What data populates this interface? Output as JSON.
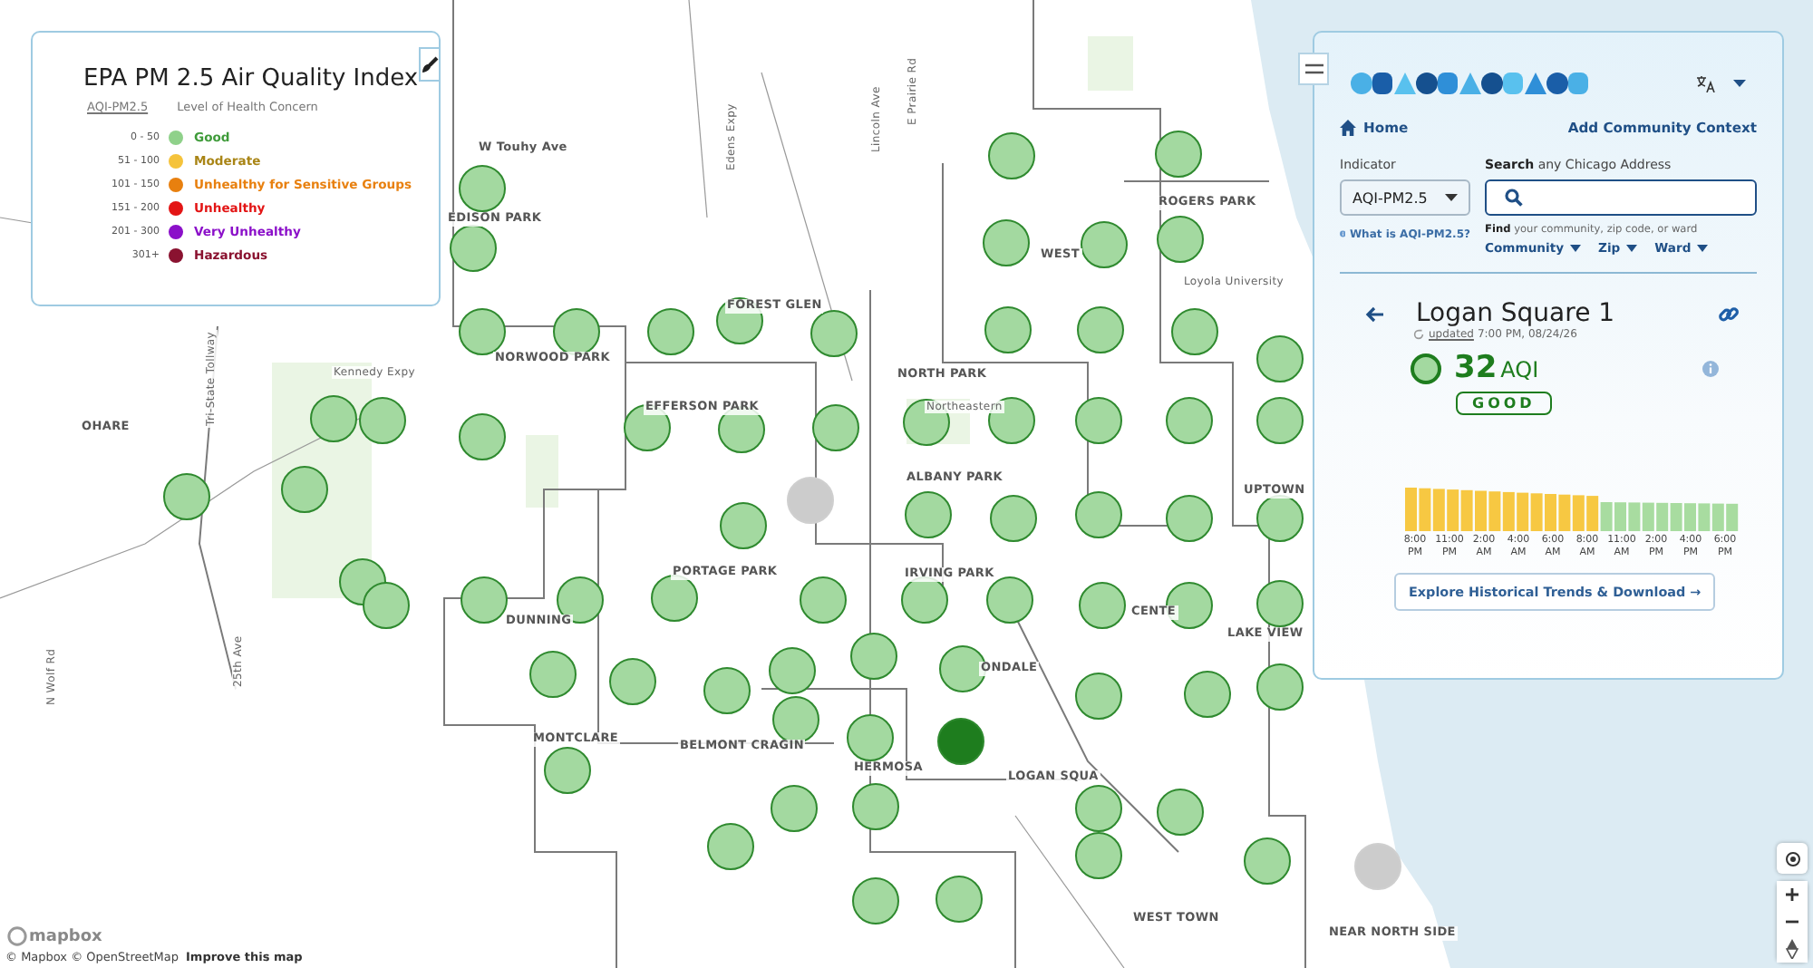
{
  "legend": {
    "title": "EPA PM 2.5 Air Quality Index",
    "column_1": "AQI-PM2.5",
    "column_2": "Level of Health Concern",
    "rows": [
      {
        "range": "0 - 50",
        "label": "Good",
        "color": "#8fd18a"
      },
      {
        "range": "51 - 100",
        "label": "Moderate",
        "color": "#f5c33b"
      },
      {
        "range": "101 - 150",
        "label": "Unhealthy for Sensitive Groups",
        "color": "#e8800f"
      },
      {
        "range": "151 - 200",
        "label": "Unhealthy",
        "color": "#e31515"
      },
      {
        "range": "201 - 300",
        "label": "Very Unhealthy",
        "color": "#8b10c9"
      },
      {
        "range": "301+",
        "label": "Hazardous",
        "color": "#8a1230"
      }
    ]
  },
  "map": {
    "labels": [
      "W Touhy Ave",
      "EDISON PARK",
      "Edens Expy",
      "E Prairie Rd",
      "Lincoln Ave",
      "ROGERS PARK",
      "WEST",
      "Loyola University",
      "FOREST GLEN",
      "NORWOOD PARK",
      "Kennedy Expy",
      "NORTH PARK",
      "Northeastern",
      "EFFERSON PARK",
      "OHARE",
      "Tri-State Tollway",
      "ALBANY PARK",
      "UPTOWN",
      "PORTAGE PARK",
      "IRVING PARK",
      "DUNNING",
      "LAKE VIEW",
      "CENTE",
      "ONDALE",
      "MONTCLARE",
      "BELMONT CRAGIN",
      "HERMOSA",
      "LOGAN SQUA",
      "N Wolf Rd",
      "25th Ave",
      "WEST TOWN",
      "NEAR NORTH SIDE"
    ],
    "markers": [
      {
        "color": "#a3d9a0"
      },
      {
        "color": "#a3d9a0"
      },
      {
        "color": "#a3d9a0"
      },
      {
        "color": "#a3d9a0"
      },
      {
        "color": "#a3d9a0"
      },
      {
        "color": "#a3d9a0"
      },
      {
        "color": "#a3d9a0"
      },
      {
        "color": "#a3d9a0"
      },
      {
        "color": "#a3d9a0"
      },
      {
        "color": "#a3d9a0"
      },
      {
        "color": "#a3d9a0"
      },
      {
        "color": "#a3d9a0"
      },
      {
        "color": "#a3d9a0"
      },
      {
        "color": "#a3d9a0"
      },
      {
        "color": "#a3d9a0"
      },
      {
        "color": "#a3d9a0"
      },
      {
        "color": "#a3d9a0"
      },
      {
        "color": "#a3d9a0"
      },
      {
        "color": "#a3d9a0"
      },
      {
        "color": "#a3d9a0"
      },
      {
        "color": "#a3d9a0"
      },
      {
        "color": "#a3d9a0"
      },
      {
        "color": "#a3d9a0"
      },
      {
        "color": "#a3d9a0"
      },
      {
        "color": "#a3d9a0"
      },
      {
        "color": "#a3d9a0"
      },
      {
        "color": "#a3d9a0"
      },
      {
        "color": "#a3d9a0"
      },
      {
        "color": "#a3d9a0"
      },
      {
        "color": "#cccccc"
      },
      {
        "color": "#a3d9a0"
      },
      {
        "color": "#a3d9a0"
      },
      {
        "color": "#a3d9a0"
      },
      {
        "color": "#a3d9a0"
      },
      {
        "color": "#a3d9a0"
      },
      {
        "color": "#a3d9a0"
      },
      {
        "color": "#a3d9a0"
      },
      {
        "color": "#a3d9a0"
      },
      {
        "color": "#a3d9a0"
      },
      {
        "color": "#a3d9a0"
      },
      {
        "color": "#a3d9a0"
      },
      {
        "color": "#a3d9a0"
      },
      {
        "color": "#a3d9a0"
      },
      {
        "color": "#a3d9a0"
      },
      {
        "color": "#a3d9a0"
      },
      {
        "color": "#a3d9a0"
      },
      {
        "color": "#a3d9a0"
      },
      {
        "color": "#a3d9a0"
      },
      {
        "color": "#a3d9a0"
      },
      {
        "color": "#a3d9a0"
      },
      {
        "color": "#a3d9a0"
      },
      {
        "color": "#a3d9a0"
      },
      {
        "color": "#a3d9a0"
      },
      {
        "color": "#a3d9a0"
      },
      {
        "color": "#1e7d1e"
      },
      {
        "color": "#a3d9a0"
      },
      {
        "color": "#a3d9a0"
      },
      {
        "color": "#a3d9a0"
      },
      {
        "color": "#a3d9a0"
      },
      {
        "color": "#a3d9a0"
      },
      {
        "color": "#a3d9a0"
      },
      {
        "color": "#a3d9a0"
      },
      {
        "color": "#a3d9a0"
      },
      {
        "color": "#a3d9a0"
      },
      {
        "color": "#a3d9a0"
      },
      {
        "color": "#a3d9a0"
      },
      {
        "color": "#a3d9a0"
      },
      {
        "color": "#a3d9a0"
      },
      {
        "color": "#a3d9a0"
      },
      {
        "color": "#cccccc"
      }
    ],
    "attribution": "© Mapbox © OpenStreetMap",
    "improve_link": "Improve this map",
    "mapbox_logo": "mapbox"
  },
  "panel": {
    "home": "Home",
    "add_context": "Add Community Context",
    "indicator_label": "Indicator",
    "indicator_value": "AQI-PM2.5",
    "search_label": "**Search** any Chicago Address",
    "help_link": "What is AQI-PM2.5?",
    "find_text": "**Find** your community, zip code, or ward",
    "filters": [
      "Community",
      "Zip",
      "Ward"
    ],
    "station": {
      "name": "Logan Square 1",
      "updated_link": "updated",
      "updated_time": "7:00 PM, 08/24/26",
      "value": "32",
      "unit": "AQI",
      "category": "GOOD",
      "color": "#a3d9a0"
    },
    "time_labels": [
      [
        "8:00",
        "PM"
      ],
      [
        "11:00",
        "PM"
      ],
      [
        "2:00",
        "AM"
      ],
      [
        "4:00",
        "AM"
      ],
      [
        "6:00",
        "AM"
      ],
      [
        "8:00",
        "AM"
      ],
      [
        "11:00",
        "AM"
      ],
      [
        "2:00",
        "PM"
      ],
      [
        "4:00",
        "PM"
      ],
      [
        "6:00",
        "PM"
      ]
    ],
    "explore_button": "Explore Historical Trends & Download →"
  }
}
